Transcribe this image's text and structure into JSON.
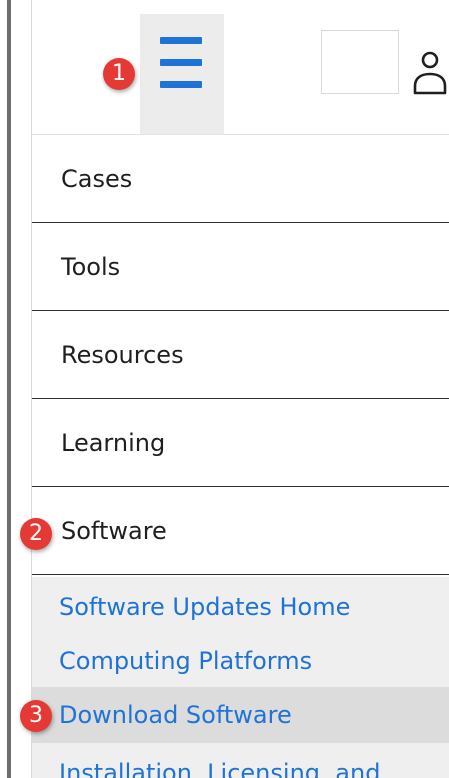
{
  "header": {
    "menu_icon": "hamburger-menu-icon",
    "user_icon": "user-profile-icon",
    "search_value": ""
  },
  "nav": {
    "items": [
      {
        "label": "Cases"
      },
      {
        "label": "Tools"
      },
      {
        "label": "Resources"
      },
      {
        "label": "Learning"
      },
      {
        "label": "Software"
      }
    ]
  },
  "software_submenu": {
    "items": [
      {
        "label": "Software Updates Home"
      },
      {
        "label": "Computing Platforms"
      },
      {
        "label": "Download Software"
      },
      {
        "label": "Installation, Licensing, and"
      }
    ]
  },
  "markers": [
    "1",
    "2",
    "3"
  ],
  "colors": {
    "accent": "#1f73d6",
    "marker": "#e53935",
    "submenu_bg": "#efefef",
    "active_submenu_bg": "#dcdcdc"
  }
}
